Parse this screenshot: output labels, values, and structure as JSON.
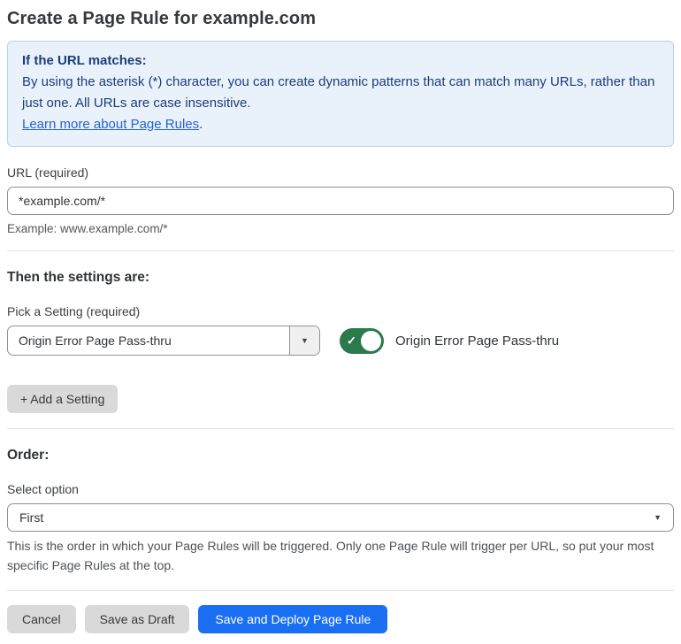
{
  "page": {
    "title": "Create a Page Rule for example.com"
  },
  "callout": {
    "heading": "If the URL matches:",
    "body": "By using the asterisk (*) character, you can create dynamic patterns that can match many URLs, rather than just one. All URLs are case insensitive.",
    "link_label": "Learn more about Page Rules",
    "link_suffix": "."
  },
  "url_section": {
    "label": "URL (required)",
    "value": "*example.com/*",
    "helper": "Example: www.example.com/*"
  },
  "settings_section": {
    "heading": "Then the settings are:",
    "pick_label": "Pick a Setting (required)",
    "selected_setting": "Origin Error Page Pass-thru",
    "toggle_state": "on",
    "toggle_label": "Origin Error Page Pass-thru",
    "add_button_label": "+ Add a Setting"
  },
  "order_section": {
    "heading": "Order:",
    "label": "Select option",
    "selected_option": "First",
    "helper": "This is the order in which your Page Rules will be triggered. Only one Page Rule will trigger per URL, so put your most specific Page Rules at the top."
  },
  "actions": {
    "cancel_label": "Cancel",
    "save_draft_label": "Save as Draft",
    "save_deploy_label": "Save and Deploy Page Rule"
  },
  "icons": {
    "dropdown_arrow": "▼",
    "toggle_check": "✓"
  },
  "colors": {
    "callout_bg": "#e9f2fb",
    "callout_border": "#b9d2ea",
    "callout_text": "#1d3d79",
    "link_blue": "#2563d4",
    "toggle_green": "#2a7a4b",
    "primary_blue": "#1a6ef2",
    "button_gray": "#d9d9d9",
    "divider": "#e3e4e5"
  }
}
